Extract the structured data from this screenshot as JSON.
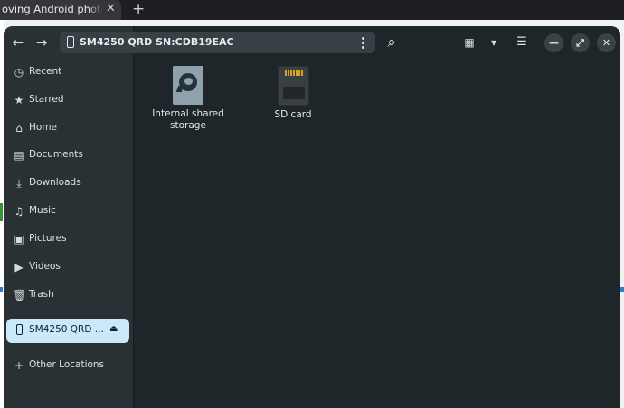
{
  "browser": {
    "tab_title": "oving Android photos to",
    "tab_close": "✕",
    "new_tab": "+"
  },
  "header": {
    "back_icon": "←",
    "forward_icon": "→",
    "path_label": "SM4250 QRD  SN:CDB19EAC",
    "search_icon": "⌕",
    "view_icon": "▦",
    "dropdown_icon": "▾",
    "menu_icon": "☰",
    "minimize_icon": "—",
    "maximize_icon": "⤢",
    "close_icon": "✕"
  },
  "sidebar": {
    "items": [
      {
        "label": "Recent",
        "icon": "◷"
      },
      {
        "label": "Starred",
        "icon": "★"
      },
      {
        "label": "Home",
        "icon": "⌂"
      },
      {
        "label": "Documents",
        "icon": "▤"
      },
      {
        "label": "Downloads",
        "icon": "⤓"
      },
      {
        "label": "Music",
        "icon": "♫"
      },
      {
        "label": "Pictures",
        "icon": "▣"
      },
      {
        "label": "Videos",
        "icon": "▶"
      },
      {
        "label": "Trash",
        "icon": "🗑"
      }
    ],
    "device": {
      "label": "SM4250 QRD ...",
      "eject_icon": "⏏"
    },
    "other": {
      "label": "Other Locations",
      "icon": "+"
    }
  },
  "files": [
    {
      "label": "Internal shared storage",
      "icon": "drive-icon"
    },
    {
      "label": "SD card",
      "icon": "sd-card-icon"
    }
  ],
  "colors": {
    "window_bg": "#1f262a",
    "sidebar_bg": "#2a3134",
    "selected_bg": "#c9e9fb"
  }
}
